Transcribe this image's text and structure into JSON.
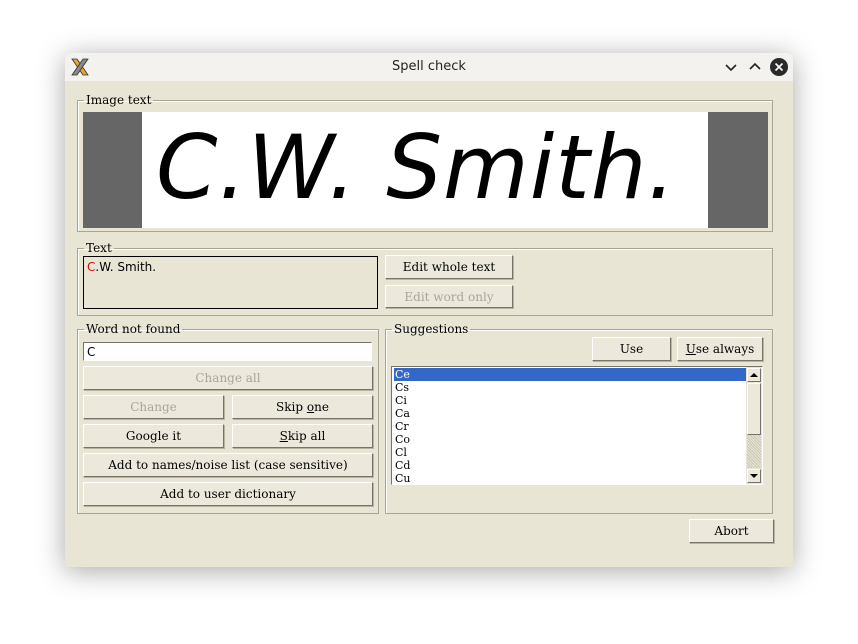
{
  "window": {
    "title": "Spell check"
  },
  "image_text": {
    "legend": "Image text",
    "content": "C.W. Smith."
  },
  "text": {
    "legend": "Text",
    "highlighted": "C",
    "rest": ".W. Smith.",
    "edit_whole_label": "Edit whole text",
    "edit_word_label": "Edit word only"
  },
  "word_not_found": {
    "legend": "Word not found",
    "value": "C",
    "change_all_label": "Change all",
    "change_label": "Change",
    "skip_one_label_pre": "Skip ",
    "skip_one_label_u": "o",
    "skip_one_label_post": "ne",
    "google_label": "Google it",
    "skip_all_label_u": "S",
    "skip_all_label_post": "kip all",
    "add_names_label": "Add to names/noise list (case sensitive)",
    "add_user_dict_label": "Add to user dictionary"
  },
  "suggestions": {
    "legend": "Suggestions",
    "use_label": "Use",
    "use_always_u": "U",
    "use_always_post": "se always",
    "items": [
      "Ce",
      "Cs",
      "Ci",
      "Ca",
      "Cr",
      "Co",
      "Cl",
      "Cd",
      "Cu"
    ],
    "selected_index": 0
  },
  "abort_label": "Abort",
  "colors": {
    "dialog_bg": "#e9e5d4",
    "selection": "#3468c8",
    "error_highlight": "#d01010"
  }
}
